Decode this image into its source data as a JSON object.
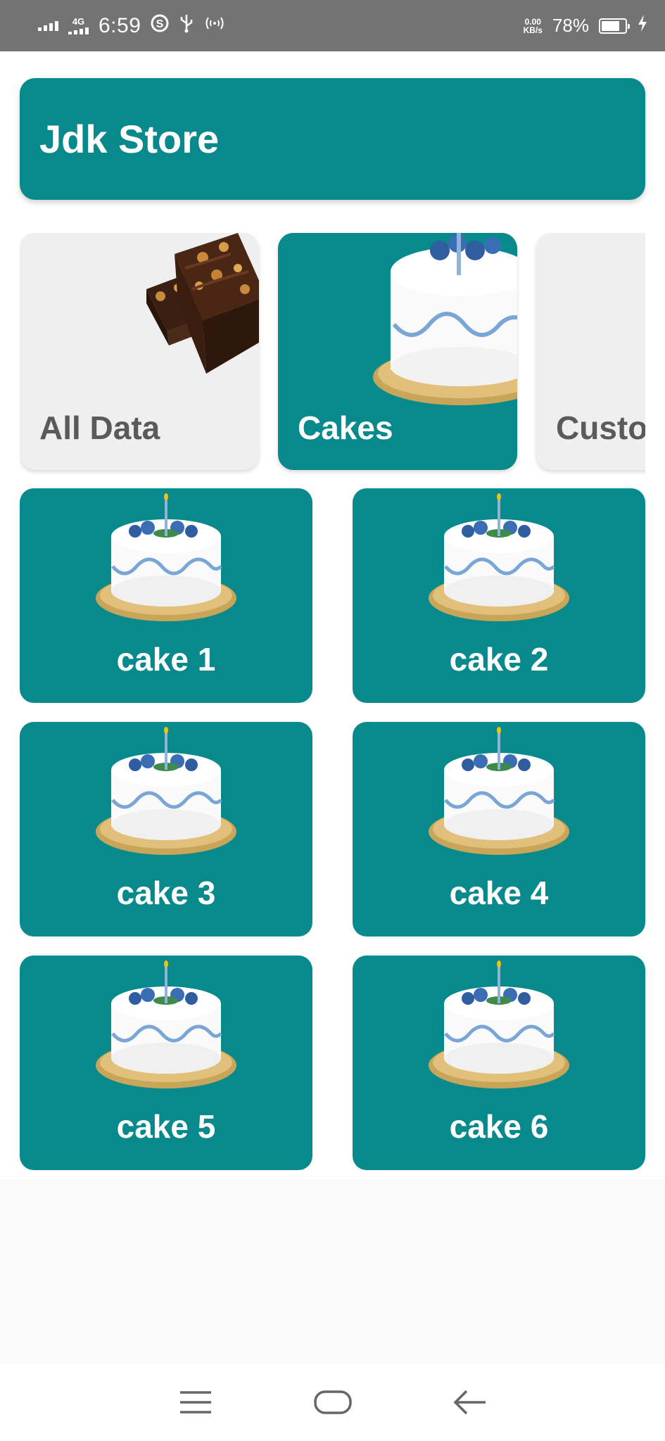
{
  "status_bar": {
    "network": "4G",
    "time": "6:59",
    "net_speed_value": "0.00",
    "net_speed_unit": "KB/s",
    "battery_percent": "78%",
    "battery_level": 0.78
  },
  "app": {
    "title": "Jdk Store",
    "accent_color": "#088a8c"
  },
  "categories": [
    {
      "label": "All Data",
      "selected": false,
      "icon": "brownie-image"
    },
    {
      "label": "Cakes",
      "selected": true,
      "icon": "cake-image"
    },
    {
      "label": "Custo",
      "selected": false,
      "icon": ""
    }
  ],
  "products": [
    {
      "label": "cake 1",
      "icon": "cake-image"
    },
    {
      "label": "cake 2",
      "icon": "cake-image"
    },
    {
      "label": "cake 3",
      "icon": "cake-image"
    },
    {
      "label": "cake 4",
      "icon": "cake-image"
    },
    {
      "label": "cake 5",
      "icon": "cake-image"
    },
    {
      "label": "cake 6",
      "icon": "cake-image"
    }
  ],
  "nav_bar": {
    "items": [
      "menu-icon",
      "home-icon",
      "back-icon"
    ]
  }
}
